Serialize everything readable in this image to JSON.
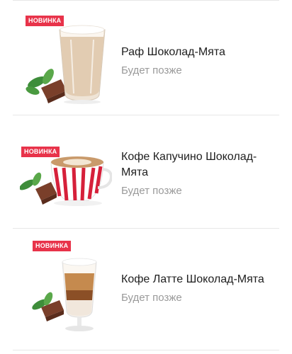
{
  "products": [
    {
      "badge": "НОВИНКА",
      "title": "Раф Шоколад-Мята",
      "status": "Будет позже",
      "image": "raf-glass-with-mint-chocolate"
    },
    {
      "badge": "НОВИНКА",
      "title": "Кофе Капучино Шоколад-Мята",
      "status": "Будет позже",
      "image": "cappuccino-cup-with-mint-chocolate"
    },
    {
      "badge": "НОВИНКА",
      "title": "Кофе Латте Шоколад-Мята",
      "status": "Будет позже",
      "image": "latte-glass-with-mint-chocolate"
    }
  ],
  "colors": {
    "badge": "#e8334a",
    "title": "#1e1e1e",
    "status": "#9a9a9a",
    "divider": "#e7e7e7"
  }
}
